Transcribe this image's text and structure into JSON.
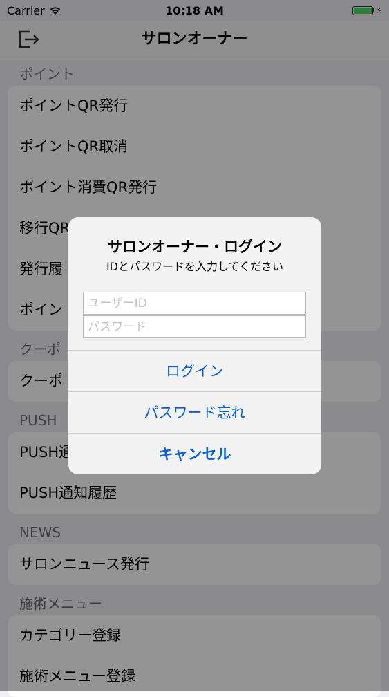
{
  "status_bar": {
    "carrier": "Carrier",
    "time": "10:18 AM"
  },
  "navbar": {
    "title": "サロンオーナー",
    "logout_icon": "logout-icon"
  },
  "sections": [
    {
      "header": "ポイント",
      "items": [
        "ポイントQR発行",
        "ポイントQR取消",
        "ポイント消費QR発行",
        "移行QR",
        "発行履",
        "ポイン"
      ]
    },
    {
      "header": "クーポ",
      "items": [
        "クーポ"
      ]
    },
    {
      "header": "PUSH",
      "items": [
        "PUSH通",
        "PUSH通知履歴"
      ]
    },
    {
      "header": "NEWS",
      "items": [
        "サロンニュース発行"
      ]
    },
    {
      "header": "施術メニュー",
      "items": [
        "カテゴリー登録",
        "施術メニュー登録"
      ]
    }
  ],
  "alert": {
    "title": "サロンオーナー・ログイン",
    "message": "IDとパスワードを入力してください",
    "user_id_placeholder": "ユーザーID",
    "password_placeholder": "パスワード",
    "login_button": "ログイン",
    "forgot_password_button": "パスワード忘れ",
    "cancel_button": "キャンセル"
  },
  "colors": {
    "accent": "#0a60d9",
    "battery": "#4cd964"
  }
}
